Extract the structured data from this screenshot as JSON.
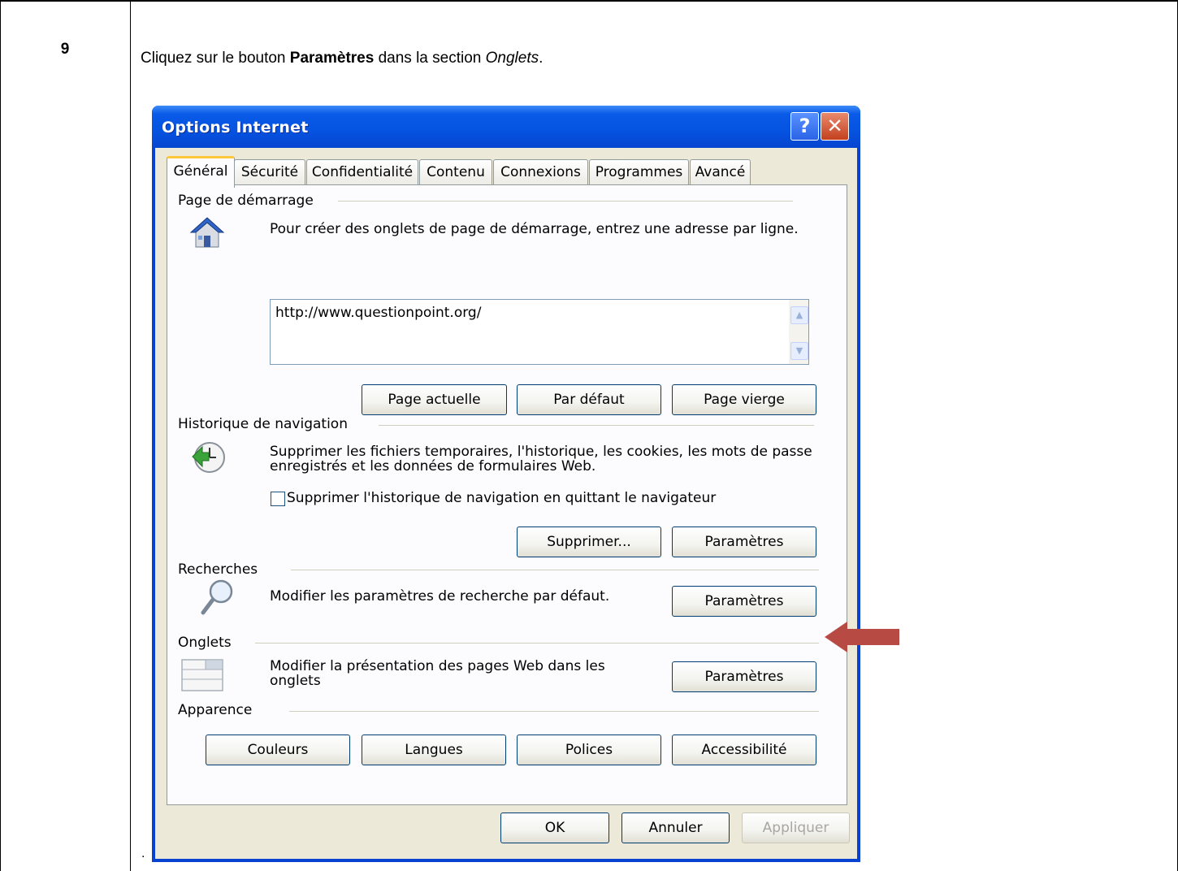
{
  "doc": {
    "step_number": "9",
    "instruction_pre": "Cliquez sur le bouton ",
    "instruction_bold": "Paramètres",
    "instruction_mid": " dans la section ",
    "instruction_italic": "Onglets",
    "instruction_end": ".",
    "trailing_dot": "."
  },
  "window": {
    "title": "Options Internet",
    "help_symbol": "?",
    "close_symbol": "✕"
  },
  "tabs": [
    "Général",
    "Sécurité",
    "Confidentialité",
    "Contenu",
    "Connexions",
    "Programmes",
    "Avancé"
  ],
  "startup": {
    "label": "Page de démarrage",
    "description": "Pour créer des onglets de page de démarrage, entrez une adresse par ligne.",
    "url": "http://www.questionpoint.org/",
    "btn_current": "Page actuelle",
    "btn_default": "Par défaut",
    "btn_blank": "Page vierge"
  },
  "history": {
    "label": "Historique de navigation",
    "description_line1": "Supprimer les fichiers temporaires, l'historique, les cookies, les mots de passe",
    "description_line2": "enregistrés et les données de formulaires Web.",
    "checkbox_label": "Supprimer l'historique de navigation en quittant le navigateur",
    "btn_delete": "Supprimer...",
    "btn_settings": "Paramètres"
  },
  "search": {
    "label": "Recherches",
    "description": "Modifier les paramètres de recherche par défaut.",
    "btn_settings": "Paramètres"
  },
  "tabs_section": {
    "label": "Onglets",
    "description_line1": "Modifier la présentation des pages Web dans les",
    "description_line2": "onglets",
    "btn_settings": "Paramètres"
  },
  "appearance": {
    "label": "Apparence",
    "btn_colors": "Couleurs",
    "btn_languages": "Langues",
    "btn_fonts": "Polices",
    "btn_accessibility": "Accessibilité"
  },
  "footer": {
    "ok": "OK",
    "cancel": "Annuler",
    "apply": "Appliquer"
  },
  "colors": {
    "arrow": "#b84a44",
    "titlebar": "#0553e0"
  }
}
